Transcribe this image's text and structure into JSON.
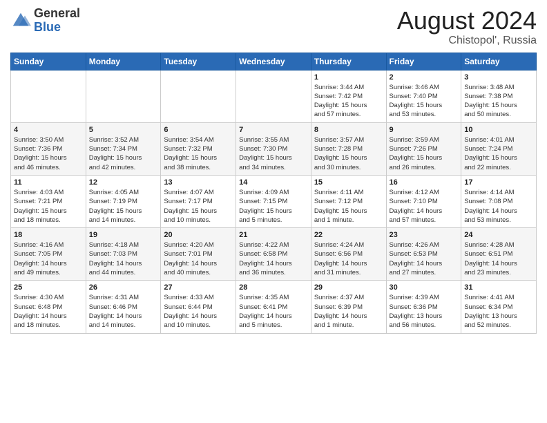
{
  "header": {
    "logo_general": "General",
    "logo_blue": "Blue",
    "month_year": "August 2024",
    "location": "Chistopol', Russia"
  },
  "days_of_week": [
    "Sunday",
    "Monday",
    "Tuesday",
    "Wednesday",
    "Thursday",
    "Friday",
    "Saturday"
  ],
  "weeks": [
    [
      {
        "day": "",
        "info": ""
      },
      {
        "day": "",
        "info": ""
      },
      {
        "day": "",
        "info": ""
      },
      {
        "day": "",
        "info": ""
      },
      {
        "day": "1",
        "info": "Sunrise: 3:44 AM\nSunset: 7:42 PM\nDaylight: 15 hours\nand 57 minutes."
      },
      {
        "day": "2",
        "info": "Sunrise: 3:46 AM\nSunset: 7:40 PM\nDaylight: 15 hours\nand 53 minutes."
      },
      {
        "day": "3",
        "info": "Sunrise: 3:48 AM\nSunset: 7:38 PM\nDaylight: 15 hours\nand 50 minutes."
      }
    ],
    [
      {
        "day": "4",
        "info": "Sunrise: 3:50 AM\nSunset: 7:36 PM\nDaylight: 15 hours\nand 46 minutes."
      },
      {
        "day": "5",
        "info": "Sunrise: 3:52 AM\nSunset: 7:34 PM\nDaylight: 15 hours\nand 42 minutes."
      },
      {
        "day": "6",
        "info": "Sunrise: 3:54 AM\nSunset: 7:32 PM\nDaylight: 15 hours\nand 38 minutes."
      },
      {
        "day": "7",
        "info": "Sunrise: 3:55 AM\nSunset: 7:30 PM\nDaylight: 15 hours\nand 34 minutes."
      },
      {
        "day": "8",
        "info": "Sunrise: 3:57 AM\nSunset: 7:28 PM\nDaylight: 15 hours\nand 30 minutes."
      },
      {
        "day": "9",
        "info": "Sunrise: 3:59 AM\nSunset: 7:26 PM\nDaylight: 15 hours\nand 26 minutes."
      },
      {
        "day": "10",
        "info": "Sunrise: 4:01 AM\nSunset: 7:24 PM\nDaylight: 15 hours\nand 22 minutes."
      }
    ],
    [
      {
        "day": "11",
        "info": "Sunrise: 4:03 AM\nSunset: 7:21 PM\nDaylight: 15 hours\nand 18 minutes."
      },
      {
        "day": "12",
        "info": "Sunrise: 4:05 AM\nSunset: 7:19 PM\nDaylight: 15 hours\nand 14 minutes."
      },
      {
        "day": "13",
        "info": "Sunrise: 4:07 AM\nSunset: 7:17 PM\nDaylight: 15 hours\nand 10 minutes."
      },
      {
        "day": "14",
        "info": "Sunrise: 4:09 AM\nSunset: 7:15 PM\nDaylight: 15 hours\nand 5 minutes."
      },
      {
        "day": "15",
        "info": "Sunrise: 4:11 AM\nSunset: 7:12 PM\nDaylight: 15 hours\nand 1 minute."
      },
      {
        "day": "16",
        "info": "Sunrise: 4:12 AM\nSunset: 7:10 PM\nDaylight: 14 hours\nand 57 minutes."
      },
      {
        "day": "17",
        "info": "Sunrise: 4:14 AM\nSunset: 7:08 PM\nDaylight: 14 hours\nand 53 minutes."
      }
    ],
    [
      {
        "day": "18",
        "info": "Sunrise: 4:16 AM\nSunset: 7:05 PM\nDaylight: 14 hours\nand 49 minutes."
      },
      {
        "day": "19",
        "info": "Sunrise: 4:18 AM\nSunset: 7:03 PM\nDaylight: 14 hours\nand 44 minutes."
      },
      {
        "day": "20",
        "info": "Sunrise: 4:20 AM\nSunset: 7:01 PM\nDaylight: 14 hours\nand 40 minutes."
      },
      {
        "day": "21",
        "info": "Sunrise: 4:22 AM\nSunset: 6:58 PM\nDaylight: 14 hours\nand 36 minutes."
      },
      {
        "day": "22",
        "info": "Sunrise: 4:24 AM\nSunset: 6:56 PM\nDaylight: 14 hours\nand 31 minutes."
      },
      {
        "day": "23",
        "info": "Sunrise: 4:26 AM\nSunset: 6:53 PM\nDaylight: 14 hours\nand 27 minutes."
      },
      {
        "day": "24",
        "info": "Sunrise: 4:28 AM\nSunset: 6:51 PM\nDaylight: 14 hours\nand 23 minutes."
      }
    ],
    [
      {
        "day": "25",
        "info": "Sunrise: 4:30 AM\nSunset: 6:48 PM\nDaylight: 14 hours\nand 18 minutes."
      },
      {
        "day": "26",
        "info": "Sunrise: 4:31 AM\nSunset: 6:46 PM\nDaylight: 14 hours\nand 14 minutes."
      },
      {
        "day": "27",
        "info": "Sunrise: 4:33 AM\nSunset: 6:44 PM\nDaylight: 14 hours\nand 10 minutes."
      },
      {
        "day": "28",
        "info": "Sunrise: 4:35 AM\nSunset: 6:41 PM\nDaylight: 14 hours\nand 5 minutes."
      },
      {
        "day": "29",
        "info": "Sunrise: 4:37 AM\nSunset: 6:39 PM\nDaylight: 14 hours\nand 1 minute."
      },
      {
        "day": "30",
        "info": "Sunrise: 4:39 AM\nSunset: 6:36 PM\nDaylight: 13 hours\nand 56 minutes."
      },
      {
        "day": "31",
        "info": "Sunrise: 4:41 AM\nSunset: 6:34 PM\nDaylight: 13 hours\nand 52 minutes."
      }
    ]
  ]
}
